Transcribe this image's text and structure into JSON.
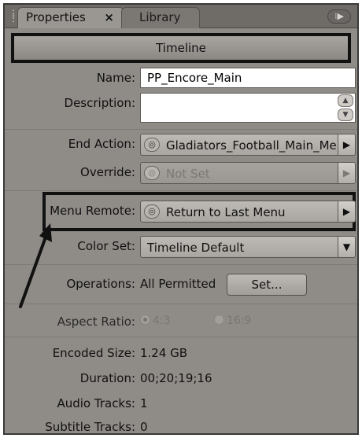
{
  "tabs": {
    "active": "Properties",
    "close_glyph": "×",
    "inactive": "Library"
  },
  "header": {
    "title": "Timeline"
  },
  "fields": {
    "name_label": "Name:",
    "name_value": "PP_Encore_Main",
    "description_label": "Description:",
    "description_value": "",
    "end_action_label": "End Action:",
    "end_action_value": "Gladiators_Football_Main_Me",
    "override_label": "Override:",
    "override_value": "Not Set",
    "menu_remote_label": "Menu Remote:",
    "menu_remote_value": "Return to Last Menu",
    "color_set_label": "Color Set:",
    "color_set_value": "Timeline Default",
    "operations_label": "Operations:",
    "operations_value": "All Permitted",
    "set_button": "Set...",
    "aspect_ratio_label": "Aspect Ratio:",
    "aspect_option_1": "4:3",
    "aspect_option_2": "16:9",
    "aspect_selected": "4:3"
  },
  "info": {
    "encoded_size_label": "Encoded Size:",
    "encoded_size_value": "1.24 GB",
    "duration_label": "Duration:",
    "duration_value": "00;20;19;16",
    "audio_tracks_label": "Audio Tracks:",
    "audio_tracks_value": "1",
    "subtitle_tracks_label": "Subtitle Tracks:",
    "subtitle_tracks_value": "0"
  },
  "icons": {
    "pick_whip": "pick-whip-icon",
    "arrow": "arrow-right-icon",
    "dropdown": "chevron-down-icon",
    "panel_menu": "panel-menu-icon"
  },
  "colors": {
    "panel_bg": "#8f8b87",
    "highlight_border": "#111111"
  }
}
